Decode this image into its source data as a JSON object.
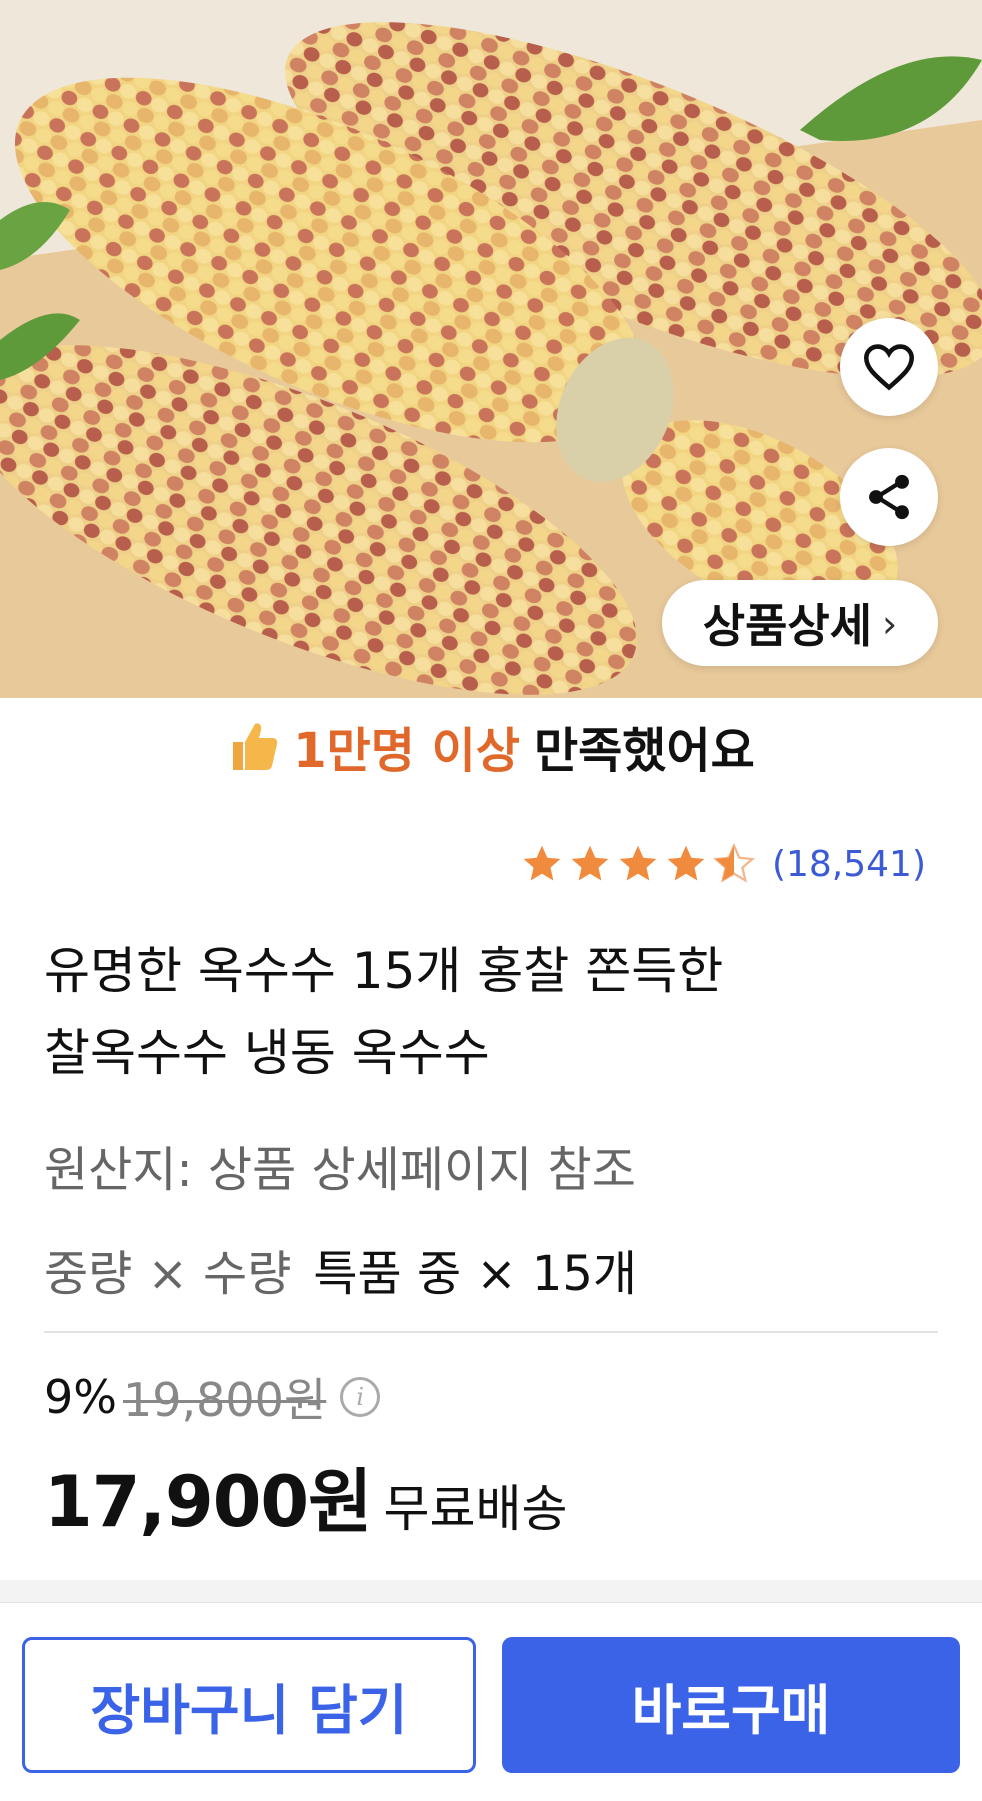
{
  "hero": {
    "image_alt": "corn",
    "detail_button_label": "상품상세",
    "detail_chevron": "›"
  },
  "icons": {
    "wishlist": "heart-icon",
    "share": "share-icon",
    "thumbs_up": "thumbs-up-icon",
    "star": "star-icon",
    "info": "info-icon"
  },
  "satisfaction": {
    "highlight": "1만명 이상",
    "text": "만족했어요"
  },
  "rating": {
    "score": 4.5,
    "max": 5,
    "count_text": "(18,541)"
  },
  "product": {
    "title_line1": "유명한 옥수수 15개 홍찰 쫀득한",
    "title_line2": "찰옥수수 냉동 옥수수",
    "origin": "원산지: 상품 상세페이지 참조",
    "option_label": "중량 × 수량",
    "option_value": "특품 중 × 15개"
  },
  "price": {
    "discount": "9%",
    "original": "19,800원",
    "current": "17,900원",
    "shipping": "무료배송"
  },
  "actions": {
    "cart": "장바구니 담기",
    "buy_now": "바로구매"
  },
  "colors": {
    "accent_blue": "#3a63e8",
    "highlight_orange": "#e1682b",
    "star_orange": "#f08a3c"
  }
}
